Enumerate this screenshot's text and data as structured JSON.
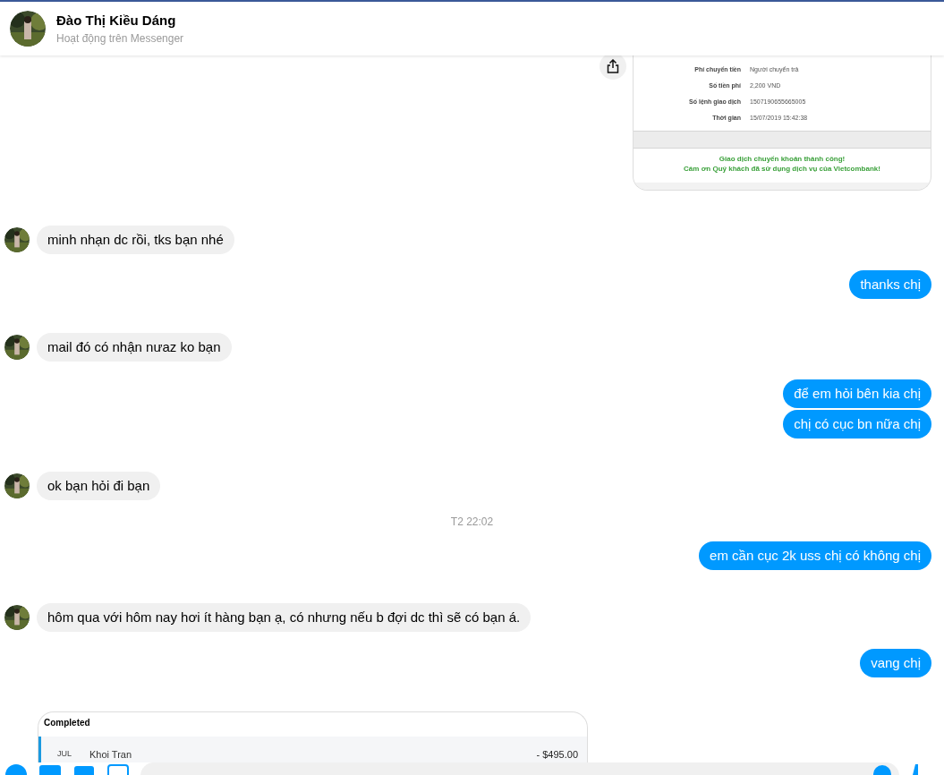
{
  "header": {
    "name": "Đào Thị Kiều Dáng",
    "status": "Hoạt động trên Messenger"
  },
  "receipt": {
    "rows": [
      {
        "label": "Phí chuyển tiền",
        "value": "Người chuyển trả"
      },
      {
        "label": "Số tiền phí",
        "value": "2,200 VND"
      },
      {
        "label": "Số lệnh giao dịch",
        "value": "1507190655665005"
      },
      {
        "label": "Thời gian",
        "value": "15/07/2019 15:42:38"
      }
    ],
    "footer": [
      "Giao dịch chuyển khoản thành công!",
      "Cám ơn Quý khách đã sử dụng dịch vụ của Vietcombank!"
    ]
  },
  "messages": [
    {
      "kind": "incoming",
      "text": "minh nhạn dc rồi, tks bạn nhé"
    },
    {
      "kind": "outgoing",
      "text": "thanks chị"
    },
    {
      "kind": "incoming",
      "text": "mail đó có nhận nưaz ko bạn"
    },
    {
      "kind": "outgoing",
      "text": "để em hỏi bên kia chị"
    },
    {
      "kind": "outgoing",
      "text": "chị có cục bn nữa chị"
    },
    {
      "kind": "incoming",
      "text": "ok bạn hỏi đi bạn"
    },
    {
      "kind": "timestamp",
      "text": "T2 22:02"
    },
    {
      "kind": "outgoing",
      "text": "em cần cục 2k uss chị có không chị"
    },
    {
      "kind": "incoming",
      "text": "hôm qua với hôm nay hơi ít hàng bạn ạ, có nhưng nếu b đợi dc thì sẽ có bạn á."
    },
    {
      "kind": "outgoing",
      "text": "vang chị"
    }
  ],
  "card": {
    "title": "Completed",
    "month": "JUL",
    "name": "Khoi Tran",
    "amount": "- $495.00"
  }
}
